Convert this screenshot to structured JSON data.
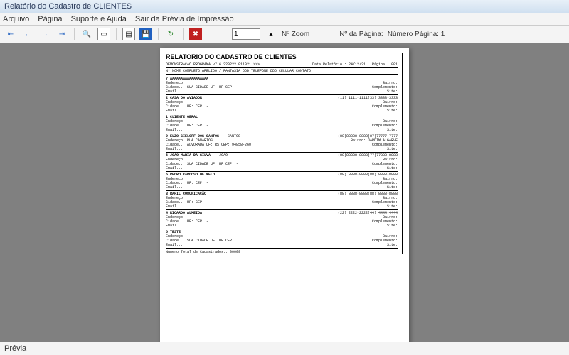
{
  "window": {
    "title": "Relatório do Cadastro de CLIENTES"
  },
  "menu": {
    "arquivo": "Arquivo",
    "pagina": "Página",
    "suporte": "Suporte e Ajuda",
    "sair": "Sair da Prévia de Impressão"
  },
  "toolbar": {
    "zoom_value": "1",
    "zoom_label": "Nº Zoom",
    "page_label": "Nº da Página:",
    "page_info": "Número Página: 1"
  },
  "report": {
    "title": "RELATORIO DO CADASTRO DE CLIENTES",
    "subtitle": "DEMONSTRAÇÃO PROGRAMA v7.6 220222 011021 >>>",
    "date_label": "Data Relatório.: 24/12/21",
    "page_label": "Página.: 001",
    "header": "Nº  NOME COMPLETO                    APELIDO / FANTASIA    DDD TELEFONE DDD CELULAR   CONTATO",
    "entries": [
      {
        "n": "7",
        "name": "AAAAAAAAAAAAAAAAAA",
        "apel": "",
        "tel": "",
        "end": "Endereço:",
        "bai": "Bairro:",
        "cid": "Cidade..: SUA CIDADE           UF: UF   CEP:",
        "comp": "Complemento:",
        "eml": "Email...:",
        "site": "Site:"
      },
      {
        "n": "2",
        "name": "CASA DO AVIADOR",
        "apel": "",
        "tel": "(11) 1111-1111(33) 3333-3333",
        "end": "Endereço:",
        "bai": "Bairro:",
        "cid": "Cidade..:                      UF:      CEP:      -",
        "comp": "Complemento:",
        "eml": "Email...:",
        "site": "Site:"
      },
      {
        "n": "1",
        "name": "CLIENTE GERAL",
        "apel": "",
        "tel": "",
        "end": "Endereço:",
        "bai": "Bairro:",
        "cid": "Cidade..:                      UF:      CEP:      -",
        "comp": "Complemento:",
        "eml": "Email...:",
        "site": "Site:"
      },
      {
        "n": "9",
        "name": "ELZO SIELOFF DOS SANTOS",
        "apel": "SANTOS",
        "tel": "(88)88888-8888(87)77777-7777",
        "end": "Endereço: RUA CANARIOS",
        "bai": "Bairro: JARDIM ALGARVE",
        "cid": "Cidade..: ALVORADA            UF: RS   CEP: 94858-260",
        "comp": "Complemento:",
        "eml": "Email...:",
        "site": "Site:"
      },
      {
        "n": "6",
        "name": "JOAO MARIA DA SILVA",
        "apel": "JOAO",
        "tel": "(88)88888-8888(77)77888-8888",
        "end": "Endereço:",
        "bai": "Bairro:",
        "cid": "Cidade..: SUA CIDADE           UF: UF   CEP:      -",
        "comp": "Complemento:",
        "eml": "Email...:",
        "site": "Site:"
      },
      {
        "n": "5",
        "name": "PEDRO CARDOSO DE MELO",
        "apel": "",
        "tel": "(88) 8888-8888(88) 8888-8888",
        "end": "Endereço:",
        "bai": "Bairro:",
        "cid": "Cidade..:                      UF:      CEP:      -",
        "comp": "Complemento:",
        "eml": "Email...:",
        "site": "Site:"
      },
      {
        "n": "3",
        "name": "RAFIL COMUNICAÇÃO",
        "apel": "",
        "tel": "(88) 8888-8888(88) 8888-8888",
        "end": "Endereço:",
        "bai": "Bairro:",
        "cid": "Cidade..:                      UF:      CEP:      -",
        "comp": "Complemento:",
        "eml": "Email...:",
        "site": "Site:"
      },
      {
        "n": "4",
        "name": "RICARDO ALMEIDA",
        "apel": "",
        "tel": "(22) 2222-2222(44) 4444-4444",
        "end": "Endereço:",
        "bai": "Bairro:",
        "cid": "Cidade..:                      UF:      CEP:      -",
        "comp": "Complemento:",
        "eml": "Email...:",
        "site": "Site:"
      },
      {
        "n": "8",
        "name": "TESTE",
        "apel": "",
        "tel": "",
        "end": "Endereço:",
        "bai": "Bairro:",
        "cid": "Cidade..: SUA CIDADE           UF: UF   CEP:",
        "comp": "Complemento:",
        "eml": "Email...:",
        "site": "Site:"
      }
    ],
    "total": "Numero Total de Cadastrados.: 00009"
  },
  "status": {
    "text": "Prévia"
  }
}
